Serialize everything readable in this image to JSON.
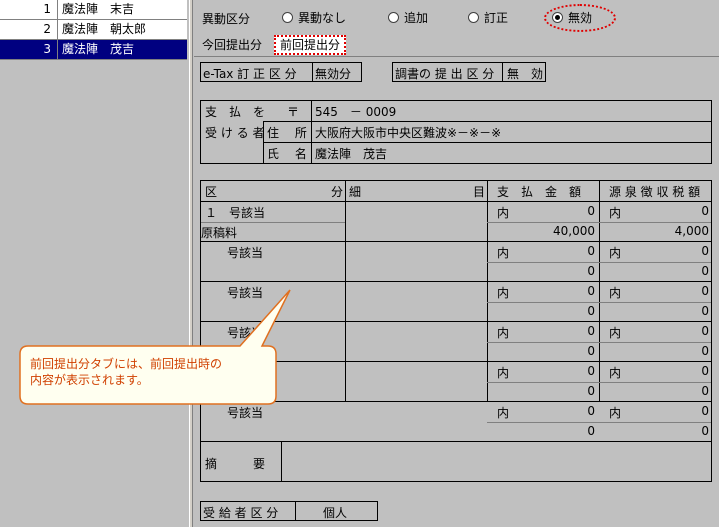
{
  "employees": [
    {
      "num": "1",
      "name": "魔法陣　末吉",
      "selected": false
    },
    {
      "num": "2",
      "name": "魔法陣　朝太郎",
      "selected": false
    },
    {
      "num": "3",
      "name": "魔法陣　茂吉",
      "selected": true
    }
  ],
  "change": {
    "label": "異動区分",
    "options": [
      {
        "label": "異動なし",
        "checked": false
      },
      {
        "label": "追加",
        "checked": false
      },
      {
        "label": "訂正",
        "checked": false
      },
      {
        "label": "無効",
        "checked": true
      }
    ]
  },
  "tabs": [
    {
      "label": "今回提出分",
      "active": false
    },
    {
      "label": "前回提出分",
      "active": true
    }
  ],
  "etax": {
    "label": "e-Tax 訂 正 区 分",
    "value": "無効分"
  },
  "submission": {
    "label": "調書の 提 出 区 分",
    "value": "無　効"
  },
  "payee": {
    "label_line1": "支　払　を",
    "label_line2": "受 け る 者",
    "postal_mark": "〒",
    "postal_code": "545　－ 0009",
    "address_label": "住　 所",
    "address": "大阪府大阪市中央区難波※－※－※",
    "name_label": "氏　 名",
    "name": "魔法陣　茂吉"
  },
  "table": {
    "headers": {
      "kubun": "区",
      "bun": "分",
      "detail": "細",
      "moku": "目",
      "amount": "支　払　金　額",
      "tax": "源 泉 徴 収 税 額"
    },
    "rows": [
      {
        "category": "１　号該当",
        "sub": "原稿料",
        "amount_prefix": "内",
        "amount_inner": "0",
        "amount": "40,000",
        "tax_prefix": "内",
        "tax_inner": "0",
        "tax": "4,000"
      },
      {
        "category": "号該当",
        "sub": "",
        "amount_prefix": "内",
        "amount_inner": "0",
        "amount": "0",
        "tax_prefix": "内",
        "tax_inner": "0",
        "tax": "0"
      },
      {
        "category": "号該当",
        "sub": "",
        "amount_prefix": "内",
        "amount_inner": "0",
        "amount": "0",
        "tax_prefix": "内",
        "tax_inner": "0",
        "tax": "0"
      },
      {
        "category": "号該当",
        "sub": "",
        "amount_prefix": "内",
        "amount_inner": "0",
        "amount": "0",
        "tax_prefix": "内",
        "tax_inner": "0",
        "tax": "0"
      },
      {
        "category": "号該当",
        "sub": "",
        "amount_prefix": "内",
        "amount_inner": "0",
        "amount": "0",
        "tax_prefix": "内",
        "tax_inner": "0",
        "tax": "0"
      },
      {
        "category": "号該当",
        "sub": "",
        "amount_prefix": "内",
        "amount_inner": "0",
        "amount": "0",
        "tax_prefix": "内",
        "tax_inner": "0",
        "tax": "0"
      }
    ],
    "summary_label": "摘　　　要"
  },
  "recipient": {
    "label": "受 給 者 区 分",
    "value": "個人"
  },
  "callout": {
    "line1": "前回提出分タブには、前回提出時の",
    "line2": "内容が表示されます。"
  },
  "colors": {
    "highlight": "#e00000",
    "selected_row": "#000080",
    "callout_fill": "#fffff0"
  }
}
